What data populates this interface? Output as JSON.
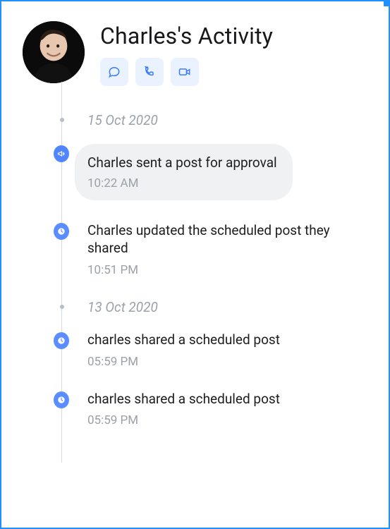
{
  "header": {
    "title": "Charles's Activity",
    "actions": {
      "chat": "chat-icon",
      "call": "phone-icon",
      "video": "video-icon"
    }
  },
  "colors": {
    "frame": "#1e90ff",
    "action_bg": "#eaf2ff",
    "action_icon": "#3a7bff",
    "bubble": "#f0f1f3",
    "badge_blue": "#4f86ff",
    "muted": "#9ba1a9"
  },
  "timeline": [
    {
      "type": "date",
      "label": "15 Oct 2020"
    },
    {
      "type": "entry",
      "icon": "megaphone",
      "highlighted": true,
      "text": "Charles sent a post for approval",
      "time": "10:22 AM"
    },
    {
      "type": "entry",
      "icon": "clock",
      "highlighted": false,
      "text": "Charles updated the scheduled post they shared",
      "time": "10:51 PM"
    },
    {
      "type": "date",
      "label": "13 Oct 2020"
    },
    {
      "type": "entry",
      "icon": "clock",
      "highlighted": false,
      "text": "charles shared a scheduled post",
      "time": "05:59 PM"
    },
    {
      "type": "entry",
      "icon": "clock",
      "highlighted": false,
      "text": "charles shared a scheduled post",
      "time": "05:59 PM"
    }
  ]
}
